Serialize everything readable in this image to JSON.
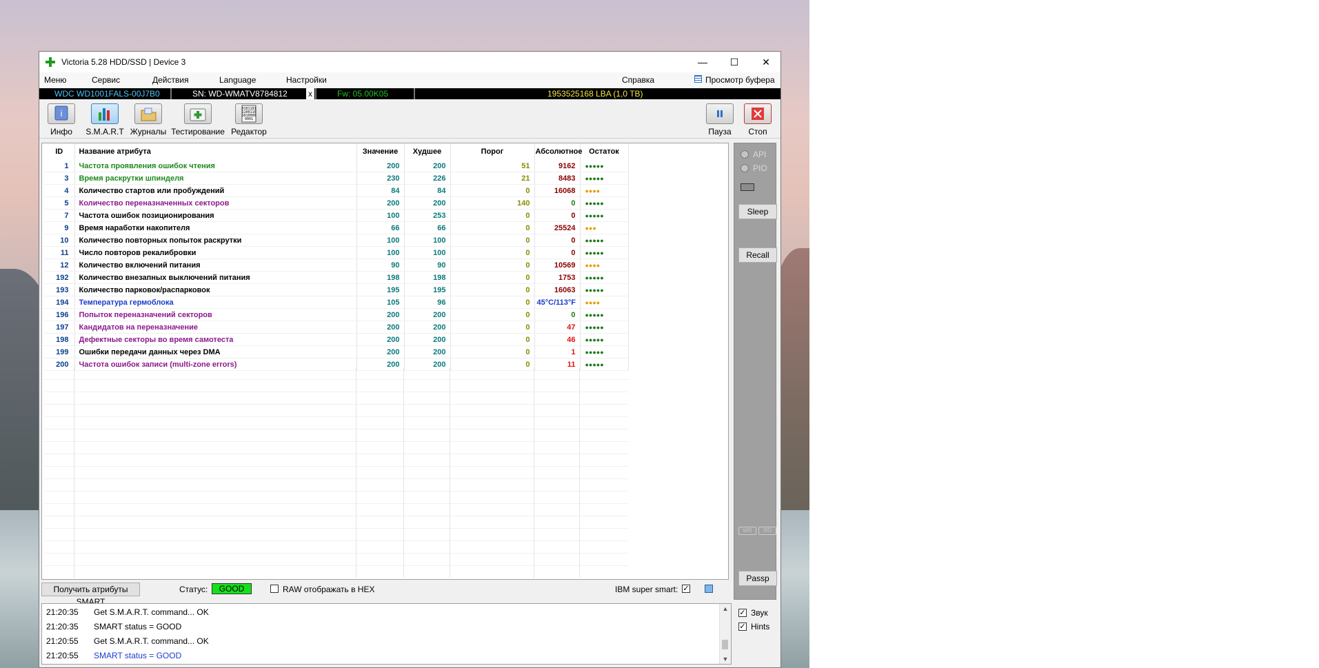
{
  "window": {
    "title": "Victoria 5.28 HDD/SSD | Device 3",
    "controls": {
      "minimize": "—",
      "maximize": "☐",
      "close": "✕"
    }
  },
  "menu": {
    "items": [
      "Меню",
      "Сервис",
      "Действия",
      "Language",
      "Настройки",
      "Справка"
    ],
    "buffer_view": "Просмотр буфера"
  },
  "drive": {
    "model": "WDC WD1001FALS-00J7B0",
    "serial": "SN: WD-WMATV8784812",
    "x": "x",
    "firmware": "Fw: 05.00K05",
    "lba": "1953525168 LBA (1,0 TB)"
  },
  "toolbar": {
    "info": "Инфо",
    "smart": "S.M.A.R.T",
    "logs": "Журналы",
    "testing": "Тестирование",
    "editor": "Редактор",
    "pause": "Пауза",
    "stop": "Стоп",
    "editor_icon_text": "0101101\n1100110\n1010000\n0001"
  },
  "smart_table": {
    "headers": [
      "ID",
      "Название атрибута",
      "Значение",
      "Худшее",
      "Порог",
      "Абсолютное",
      "Остаток"
    ],
    "rows": [
      {
        "id": "1",
        "name": "Частота проявления ошибок чтения",
        "value": "200",
        "worst": "200",
        "threshold": "51",
        "raw": "9162",
        "health": "●●●●●",
        "name_color": "#1d8a1d",
        "raw_color": "#8b0000",
        "health_color": "#1d7a1d"
      },
      {
        "id": "3",
        "name": "Время раскрутки шпинделя",
        "value": "230",
        "worst": "226",
        "threshold": "21",
        "raw": "8483",
        "health": "●●●●●",
        "name_color": "#1d8a1d",
        "raw_color": "#8b0000",
        "health_color": "#1d7a1d"
      },
      {
        "id": "4",
        "name": "Количество стартов или пробуждений",
        "value": "84",
        "worst": "84",
        "threshold": "0",
        "raw": "16068",
        "health": "●●●●",
        "name_color": "#000000",
        "raw_color": "#8b0000",
        "health_color": "#e3a000"
      },
      {
        "id": "5",
        "name": "Количество переназначенных секторов",
        "value": "200",
        "worst": "200",
        "threshold": "140",
        "raw": "0",
        "health": "●●●●●",
        "name_color": "#8b1a8b",
        "raw_color": "#1d7a1d",
        "health_color": "#1d7a1d"
      },
      {
        "id": "7",
        "name": "Частота ошибок позиционирования",
        "value": "100",
        "worst": "253",
        "threshold": "0",
        "raw": "0",
        "health": "●●●●●",
        "name_color": "#000000",
        "raw_color": "#8b0000",
        "health_color": "#1d7a1d"
      },
      {
        "id": "9",
        "name": "Время наработки накопителя",
        "value": "66",
        "worst": "66",
        "threshold": "0",
        "raw": "25524",
        "health": "●●●",
        "name_color": "#000000",
        "raw_color": "#8b0000",
        "health_color": "#e3a000"
      },
      {
        "id": "10",
        "name": "Количество повторных попыток раскрутки",
        "value": "100",
        "worst": "100",
        "threshold": "0",
        "raw": "0",
        "health": "●●●●●",
        "name_color": "#000000",
        "raw_color": "#8b0000",
        "health_color": "#1d7a1d"
      },
      {
        "id": "11",
        "name": "Число повторов рекалибровки",
        "value": "100",
        "worst": "100",
        "threshold": "0",
        "raw": "0",
        "health": "●●●●●",
        "name_color": "#000000",
        "raw_color": "#8b0000",
        "health_color": "#1d7a1d"
      },
      {
        "id": "12",
        "name": "Количество включений питания",
        "value": "90",
        "worst": "90",
        "threshold": "0",
        "raw": "10569",
        "health": "●●●●",
        "name_color": "#000000",
        "raw_color": "#8b0000",
        "health_color": "#e3a000"
      },
      {
        "id": "192",
        "name": "Количество внезапных выключений питания",
        "value": "198",
        "worst": "198",
        "threshold": "0",
        "raw": "1753",
        "health": "●●●●●",
        "name_color": "#000000",
        "raw_color": "#8b0000",
        "health_color": "#1d7a1d"
      },
      {
        "id": "193",
        "name": "Количество парковок/распарковок",
        "value": "195",
        "worst": "195",
        "threshold": "0",
        "raw": "16063",
        "health": "●●●●●",
        "name_color": "#000000",
        "raw_color": "#8b0000",
        "health_color": "#1d7a1d"
      },
      {
        "id": "194",
        "name": "Температура гермоблока",
        "value": "105",
        "worst": "96",
        "threshold": "0",
        "raw": "45°C/113°F",
        "health": "●●●●",
        "name_color": "#1a3ccc",
        "raw_color": "#1a3ccc",
        "health_color": "#e3a000"
      },
      {
        "id": "196",
        "name": "Попыток переназначений секторов",
        "value": "200",
        "worst": "200",
        "threshold": "0",
        "raw": "0",
        "health": "●●●●●",
        "name_color": "#8b1a8b",
        "raw_color": "#1d7a1d",
        "health_color": "#1d7a1d"
      },
      {
        "id": "197",
        "name": "Кандидатов на переназначение",
        "value": "200",
        "worst": "200",
        "threshold": "0",
        "raw": "47",
        "health": "●●●●●",
        "name_color": "#8b1a8b",
        "raw_color": "#e01010",
        "health_color": "#1d7a1d"
      },
      {
        "id": "198",
        "name": "Дефектные секторы во время самотеста",
        "value": "200",
        "worst": "200",
        "threshold": "0",
        "raw": "46",
        "health": "●●●●●",
        "name_color": "#8b1a8b",
        "raw_color": "#e01010",
        "health_color": "#1d7a1d"
      },
      {
        "id": "199",
        "name": "Ошибки передачи данных через DMA",
        "value": "200",
        "worst": "200",
        "threshold": "0",
        "raw": "1",
        "health": "●●●●●",
        "name_color": "#000000",
        "raw_color": "#e01010",
        "health_color": "#1d7a1d"
      },
      {
        "id": "200",
        "name": "Частота ошибок записи (multi-zone errors)",
        "value": "200",
        "worst": "200",
        "threshold": "0",
        "raw": "11",
        "health": "●●●●●",
        "name_color": "#8b1a8b",
        "raw_color": "#e01010",
        "health_color": "#1d7a1d"
      }
    ],
    "value_color": "#0a7a7a",
    "threshold_color": "#8a8a00"
  },
  "bottom_bar": {
    "get_attributes": "Получить атрибуты SMART",
    "status_label": "Статус:",
    "status_value": "GOOD",
    "raw_hex": "RAW отображать в HEX",
    "raw_hex_checked": false,
    "ibm_label": "IBM super smart:",
    "ibm_checked": true
  },
  "side_panel": {
    "api": "API",
    "pio": "PIO",
    "sleep": "Sleep",
    "recall": "Recall",
    "wr": "WR",
    "rd": "RD",
    "passp": "Passp"
  },
  "log": {
    "lines": [
      {
        "time": "21:20:35",
        "msg": "Get S.M.A.R.T. command... OK",
        "color": "#000000"
      },
      {
        "time": "21:20:35",
        "msg": "SMART status = GOOD",
        "color": "#000000"
      },
      {
        "time": "21:20:55",
        "msg": "Get S.M.A.R.T. command... OK",
        "color": "#000000"
      },
      {
        "time": "21:20:55",
        "msg": "SMART status = GOOD",
        "color": "#1a3ccc"
      }
    ]
  },
  "options": {
    "sound": "Звук",
    "sound_checked": true,
    "hints": "Hints",
    "hints_checked": true
  }
}
